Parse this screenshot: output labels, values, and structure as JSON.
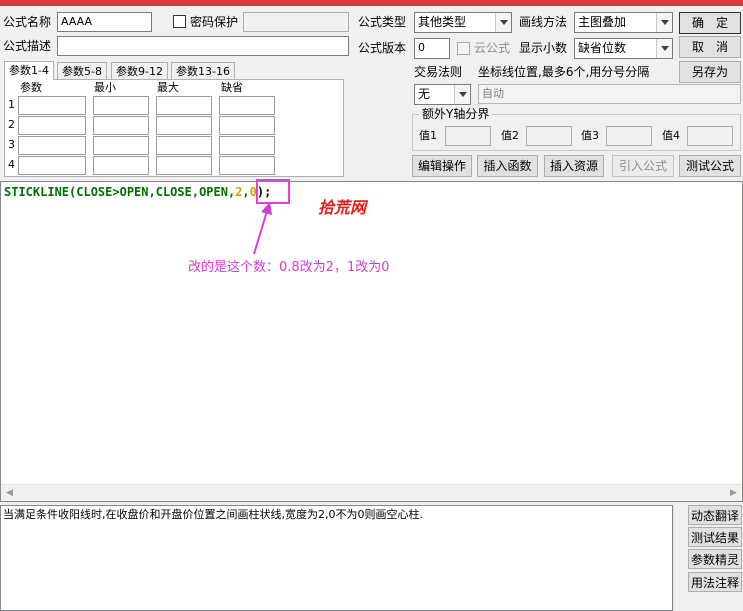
{
  "form": {
    "name_label": "公式名称",
    "name_value": "AAAA",
    "password_label": "密码保护",
    "desc_label": "公式描述",
    "desc_value": "",
    "type_label": "公式类型",
    "type_value": "其他类型",
    "draw_label": "画线方法",
    "draw_value": "主图叠加",
    "version_label": "公式版本",
    "version_value": "0",
    "cloud_label": "云公式",
    "decimal_label": "显示小数",
    "decimal_value": "缺省位数",
    "trade_label": "交易法则",
    "trade_value": "无",
    "coord_label": "坐标线位置,最多6个,用分号分隔",
    "coord_value": "自动",
    "yaxis_group_label": "额外Y轴分界",
    "yaxis_values": [
      "值1",
      "值2",
      "值3",
      "值4"
    ]
  },
  "buttons": {
    "ok": "确　定",
    "cancel": "取　消",
    "save_as": "另存为",
    "edit_ops": "编辑操作",
    "insert_func": "插入函数",
    "insert_res": "插入资源",
    "import_formula": "引入公式",
    "test_formula": "测试公式"
  },
  "params": {
    "tabs": [
      "参数1-4",
      "参数5-8",
      "参数9-12",
      "参数13-16"
    ],
    "headers": [
      "参数",
      "最小",
      "最大",
      "缺省"
    ],
    "rows": [
      "1",
      "2",
      "3",
      "4"
    ]
  },
  "code": {
    "part1": "STICKLINE(CLOSE>OPEN,CLOSE,OPEN,",
    "num1": "2",
    "comma": ",",
    "num2": "0",
    "end": ");"
  },
  "annotation": {
    "watermark": "拾荒网",
    "note": "改的是这个数：0.8改为2，1改为0",
    "highlight_color": "#e040e0"
  },
  "description": {
    "text": "当满足条件收阳线时,在收盘价和开盘价位置之间画柱状线,宽度为2,0不为0则画空心柱."
  },
  "side_buttons": [
    "动态翻译",
    "测试结果",
    "参数精灵",
    "用法注释"
  ],
  "colors": {
    "keyword": "#007000",
    "number": "#d0a000",
    "annotation": "#d43cd4",
    "watermark": "#e02020",
    "titlebar": "#d04040"
  }
}
